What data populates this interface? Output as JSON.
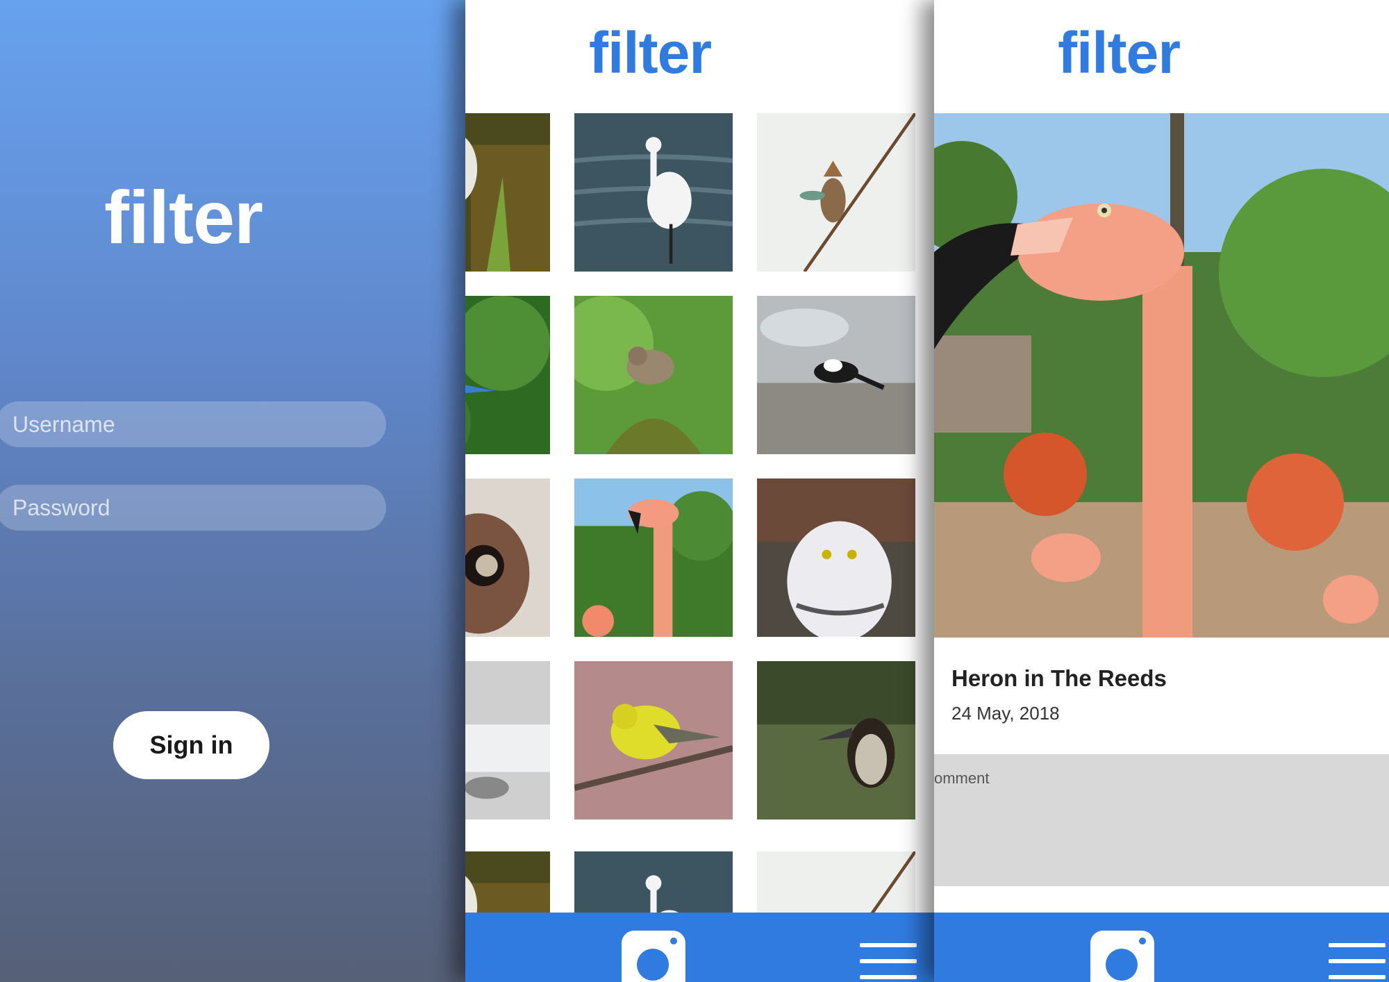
{
  "login": {
    "logo": "filter",
    "username_placeholder": "Username",
    "password_placeholder": "Password",
    "signin_label": "Sign in"
  },
  "grid": {
    "logo": "filter"
  },
  "detail": {
    "logo": "filter",
    "title": "Heron in The Reeds",
    "date": "24 May, 2018",
    "comment_placeholder": "omment"
  },
  "colors": {
    "brand_blue": "#2f7be0",
    "login_gradient_top": "#67a2ef",
    "login_gradient_bottom": "#566077"
  },
  "icons": [
    "camera-icon",
    "hamburger-menu-icon"
  ]
}
